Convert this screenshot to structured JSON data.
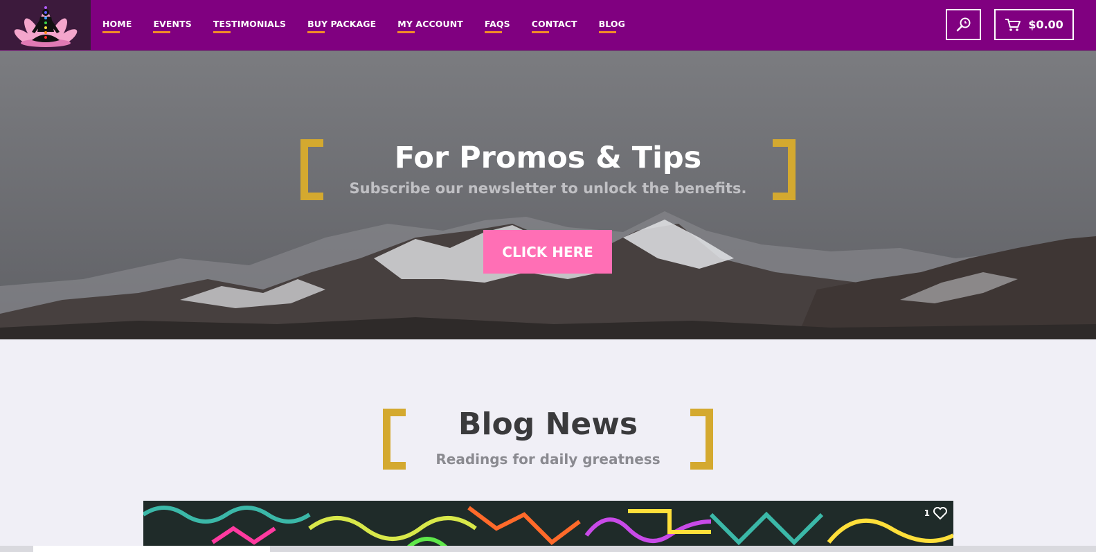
{
  "nav": {
    "items": [
      {
        "label": "HOME"
      },
      {
        "label": "EVENTS"
      },
      {
        "label": "TESTIMONIALS"
      },
      {
        "label": "BUY PACKAGE"
      },
      {
        "label": "MY ACCOUNT"
      },
      {
        "label": "FAQS"
      },
      {
        "label": "CONTACT"
      },
      {
        "label": "BLOG"
      }
    ],
    "cart_total": "$0.00",
    "logo_icon": "meditation-lotus-icon",
    "search_icon": "search-icon",
    "cart_icon": "cart-icon",
    "background": "#800080",
    "underline_color": "#f28c28"
  },
  "hero": {
    "title": "For Promos & Tips",
    "subtitle": "Subscribe our newsletter to unlock the benefits.",
    "cta_label": "CLICK HERE",
    "cta_color": "#ff6fb5",
    "bracket_color": "#d4a92f"
  },
  "blog": {
    "title": "Blog News",
    "subtitle": "Readings for daily greatness",
    "like_count": "1",
    "like_icon": "heart-icon"
  }
}
